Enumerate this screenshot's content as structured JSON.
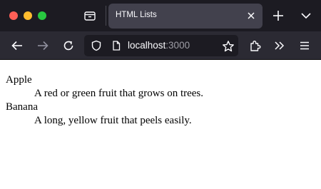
{
  "window": {
    "controls": [
      "close",
      "minimize",
      "maximize"
    ]
  },
  "tabs": [
    {
      "title": "HTML Lists",
      "active": true
    }
  ],
  "toolbar": {
    "url_host": "localhost",
    "url_port": ":3000",
    "icons": [
      "back-icon",
      "forward-icon",
      "reload-icon",
      "shield-icon",
      "page-icon",
      "bookmark-star-icon",
      "extensions-icon",
      "overflow-chevron-icon",
      "hamburger-menu-icon"
    ]
  },
  "page": {
    "definitions": [
      {
        "term": "Apple",
        "description": "A red or green fruit that grows on trees."
      },
      {
        "term": "Banana",
        "description": "A long, yellow fruit that peels easily."
      }
    ]
  },
  "colors": {
    "titlebar": "#1c1b22",
    "toolbar": "#2b2a33",
    "active_tab": "#42414d",
    "close": "#ff5f57",
    "minimize": "#febc2e",
    "maximize": "#28c840"
  }
}
